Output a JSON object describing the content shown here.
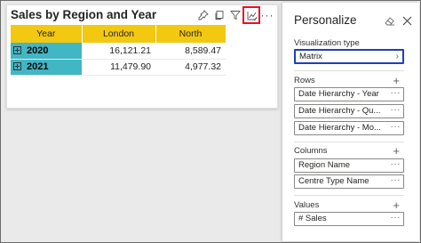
{
  "visual": {
    "title": "Sales by Region and Year",
    "icons": [
      "pin-icon",
      "copy-icon",
      "filter-icon",
      "personalize-icon",
      "more-options-icon"
    ],
    "more_label": "···"
  },
  "matrix": {
    "headers": [
      "Year",
      "London",
      "North"
    ],
    "rows": [
      {
        "year": "2020",
        "values": [
          "16,121.21",
          "8,589.47"
        ]
      },
      {
        "year": "2021",
        "values": [
          "11,479.90",
          "4,977.32"
        ]
      }
    ],
    "colors": {
      "header": "#f2c811",
      "row_header": "#41b6c4"
    }
  },
  "pane": {
    "title": "Personalize",
    "visualization_type": {
      "label": "Visualization type",
      "value": "Matrix"
    },
    "rows": {
      "label": "Rows",
      "items": [
        "Date Hierarchy - Year",
        "Date Hierarchy - Qu...",
        "Date Hierarchy - Mo..."
      ]
    },
    "columns": {
      "label": "Columns",
      "items": [
        "Region Name",
        "Centre Type Name"
      ]
    },
    "values": {
      "label": "Values",
      "items": [
        "# Sales"
      ]
    },
    "dots": "···",
    "plus": "+",
    "chevron": "›"
  }
}
